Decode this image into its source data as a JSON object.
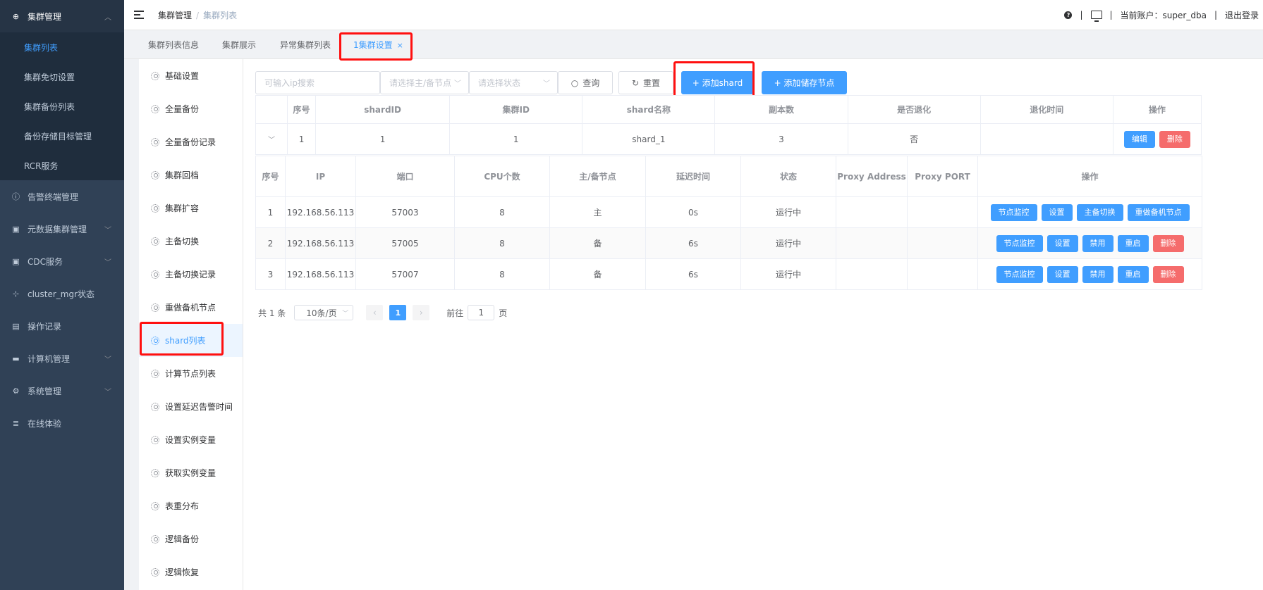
{
  "sidebar": {
    "items": [
      {
        "label": "集群管理",
        "icon": "plus-circle-icon",
        "expanded": true
      },
      {
        "label": "告警终端管理",
        "icon": "info-circle-icon"
      },
      {
        "label": "元数据集群管理",
        "icon": "disk-icon"
      },
      {
        "label": "CDC服务",
        "icon": "disk-icon"
      },
      {
        "label": "cluster_mgr状态",
        "icon": "crosshair-icon"
      },
      {
        "label": "操作记录",
        "icon": "document-icon"
      },
      {
        "label": "计算机管理",
        "icon": "monitor-icon"
      },
      {
        "label": "系统管理",
        "icon": "gear-icon"
      },
      {
        "label": "在线体验",
        "icon": "database-icon"
      }
    ],
    "submenu": [
      "集群列表",
      "集群免切设置",
      "集群备份列表",
      "备份存储目标管理",
      "RCR服务"
    ]
  },
  "header": {
    "breadcrumb": [
      "集群管理",
      "集群列表"
    ],
    "account_label": "当前账户：super_dba",
    "logout": "退出登录",
    "divider": "|"
  },
  "tabs": [
    "集群列表信息",
    "集群展示",
    "异常集群列表",
    "1集群设置"
  ],
  "settings_nav": [
    "基础设置",
    "全量备份",
    "全量备份记录",
    "集群回档",
    "集群扩容",
    "主备切换",
    "主备切换记录",
    "重做备机节点",
    "shard列表",
    "计算节点列表",
    "设置延迟告警时间",
    "设置实例变量",
    "获取实例变量",
    "表重分布",
    "逻辑备份",
    "逻辑恢复"
  ],
  "filter": {
    "ip_placeholder": "可输入ip搜索",
    "node_placeholder": "请选择主/备节点",
    "status_placeholder": "请选择状态",
    "query": "查询",
    "reset": "重置",
    "add_shard": "+ 添加shard",
    "add_storage": "+ 添加储存节点"
  },
  "shard_table": {
    "headers": [
      "",
      "序号",
      "shardID",
      "集群ID",
      "shard名称",
      "副本数",
      "是否退化",
      "退化时间",
      "操作"
    ],
    "row": [
      "1",
      "1",
      "1",
      "shard_1",
      "3",
      "否",
      ""
    ],
    "edit": "编辑",
    "delete": "删除"
  },
  "node_table": {
    "headers": [
      "序号",
      "IP",
      "端口",
      "CPU个数",
      "主/备节点",
      "延迟时间",
      "状态",
      "Proxy Address",
      "Proxy PORT",
      "操作"
    ],
    "rows": [
      {
        "no": "1",
        "ip": "192.168.56.113",
        "port": "57003",
        "cpu": "8",
        "role": "主",
        "delay": "0s",
        "status": "运行中",
        "proxy_addr": "",
        "proxy_port": "",
        "actions": [
          "节点监控",
          "设置",
          "主备切换",
          "重做备机节点"
        ]
      },
      {
        "no": "2",
        "ip": "192.168.56.113",
        "port": "57005",
        "cpu": "8",
        "role": "备",
        "delay": "6s",
        "status": "运行中",
        "proxy_addr": "",
        "proxy_port": "",
        "actions": [
          "节点监控",
          "设置",
          "禁用",
          "重启",
          "删除"
        ]
      },
      {
        "no": "3",
        "ip": "192.168.56.113",
        "port": "57007",
        "cpu": "8",
        "role": "备",
        "delay": "6s",
        "status": "运行中",
        "proxy_addr": "",
        "proxy_port": "",
        "actions": [
          "节点监控",
          "设置",
          "禁用",
          "重启",
          "删除"
        ]
      }
    ]
  },
  "pagination": {
    "total": "共 1 条",
    "page_size": "10条/页",
    "current": "1",
    "goto_prefix": "前往",
    "goto_value": "1",
    "goto_suffix": "页"
  },
  "colors": {
    "primary": "#409eff",
    "danger": "#f56c6c",
    "success": "#67c23a",
    "sidebar": "#304156",
    "highlight": "#ff1010"
  }
}
